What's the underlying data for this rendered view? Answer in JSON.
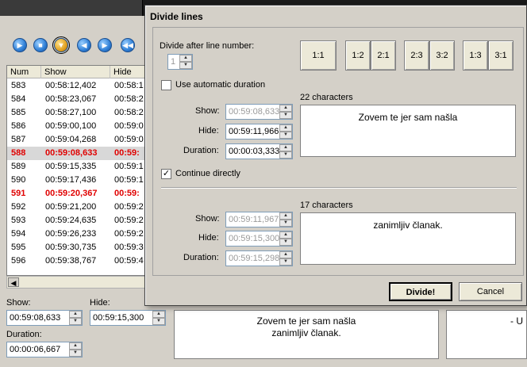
{
  "table": {
    "headers": [
      "Num",
      "Show",
      "Hide"
    ],
    "rows": [
      {
        "num": "583",
        "show": "00:58:12,402",
        "hide": "00:58:1"
      },
      {
        "num": "584",
        "show": "00:58:23,067",
        "hide": "00:58:2"
      },
      {
        "num": "585",
        "show": "00:58:27,100",
        "hide": "00:58:2"
      },
      {
        "num": "586",
        "show": "00:59:00,100",
        "hide": "00:59:0"
      },
      {
        "num": "587",
        "show": "00:59:04,268",
        "hide": "00:59:0"
      },
      {
        "num": "588",
        "show": "00:59:08,633",
        "hide": "00:59:"
      },
      {
        "num": "589",
        "show": "00:59:15,335",
        "hide": "00:59:1"
      },
      {
        "num": "590",
        "show": "00:59:17,436",
        "hide": "00:59:1"
      },
      {
        "num": "591",
        "show": "00:59:20,367",
        "hide": "00:59:"
      },
      {
        "num": "592",
        "show": "00:59:21,200",
        "hide": "00:59:2"
      },
      {
        "num": "593",
        "show": "00:59:24,635",
        "hide": "00:59:2"
      },
      {
        "num": "594",
        "show": "00:59:26,233",
        "hide": "00:59:2"
      },
      {
        "num": "595",
        "show": "00:59:30,735",
        "hide": "00:59:3"
      },
      {
        "num": "596",
        "show": "00:59:38,767",
        "hide": "00:59:4"
      }
    ]
  },
  "editor": {
    "show_label": "Show:",
    "show_value": "00:59:08,633",
    "hide_label": "Hide:",
    "hide_value": "00:59:15,300",
    "duration_label": "Duration:",
    "duration_value": "00:00:06,667",
    "preview_line1": "Zovem te jer sam našla",
    "preview_line2": "zanimljiv članak.",
    "preview_right": "- U"
  },
  "dialog": {
    "title": "Divide lines",
    "divide_after_label": "Divide after line number:",
    "divide_after_value": "1",
    "ratios": [
      "1:1",
      "1:2",
      "2:1",
      "2:3",
      "3:2",
      "1:3",
      "3:1"
    ],
    "auto_duration_label": "Use automatic duration",
    "auto_duration_checked": false,
    "continue_label": "Continue directly",
    "continue_checked": true,
    "part1": {
      "chars": "22 characters",
      "text": "Zovem te jer sam našla",
      "show_label": "Show:",
      "show": "00:59:08,633",
      "hide_label": "Hide:",
      "hide": "00:59:11,966",
      "duration_label": "Duration:",
      "duration": "00:00:03,333"
    },
    "part2": {
      "chars": "17 characters",
      "text": "zanimljiv članak.",
      "show_label": "Show:",
      "show": "00:59:11,967",
      "hide_label": "Hide:",
      "hide": "00:59:15,300",
      "duration_label": "Duration:",
      "duration": "00:59:15,298"
    },
    "divide_button": "Divide!",
    "cancel_button": "Cancel"
  }
}
